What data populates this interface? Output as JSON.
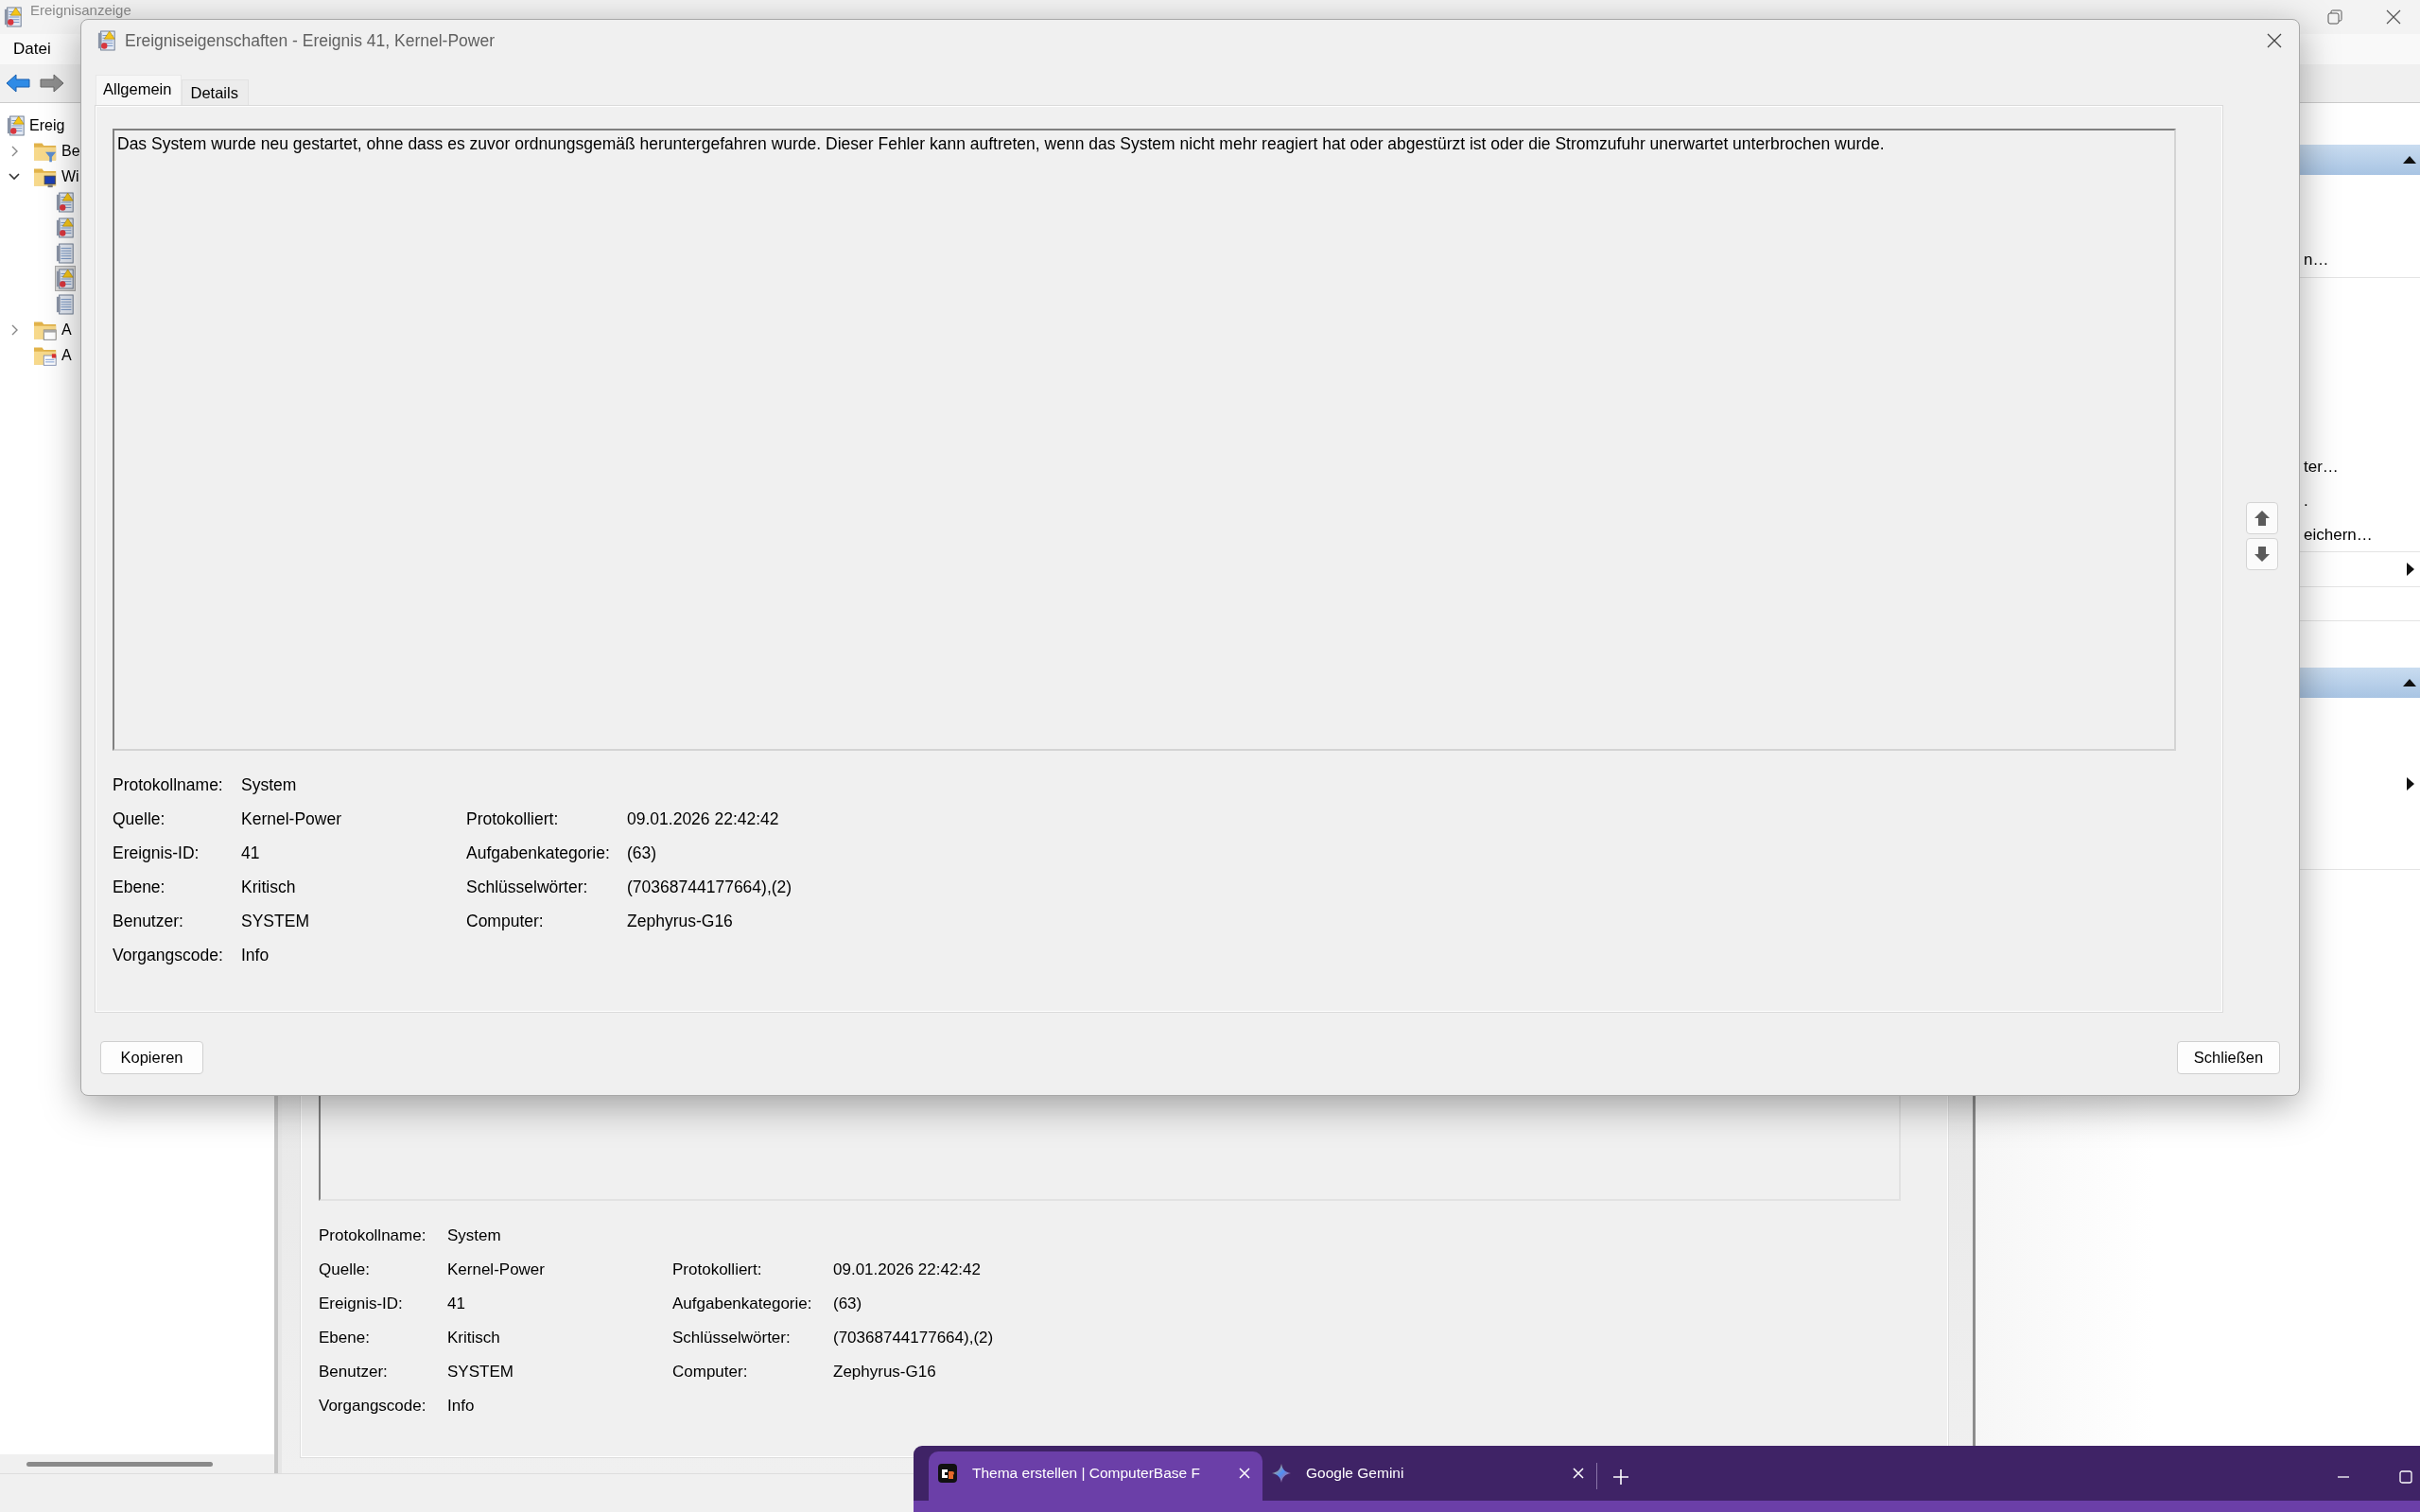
{
  "event_viewer": {
    "title": "Ereignisanzeige",
    "menu": [
      "Datei"
    ],
    "tree": [
      {
        "label": "Ereig",
        "kind": "viewer",
        "selected": false,
        "children": [
          {
            "label": "Be",
            "kind": "filter-folder",
            "selected": false,
            "expanded": false
          },
          {
            "label": "Wi",
            "kind": "computer-folder",
            "selected": false,
            "expanded": true,
            "children": [
              {
                "kind": "alert-log",
                "selected": false
              },
              {
                "kind": "alert-log",
                "selected": false
              },
              {
                "kind": "plain-log",
                "selected": false
              },
              {
                "kind": "alert-log",
                "selected": true
              },
              {
                "kind": "plain-log",
                "selected": false
              }
            ]
          },
          {
            "label": "A",
            "kind": "app-folder",
            "selected": false,
            "expanded": false
          },
          {
            "label": "A",
            "kind": "task-folder",
            "selected": false
          }
        ]
      }
    ],
    "actions": [
      {
        "items": [
          {
            "kind": "action",
            "label": "n…"
          },
          {
            "kind": "action",
            "label": "ter…"
          },
          {
            "kind": "action",
            "label": "."
          },
          {
            "kind": "action",
            "label": "eichern…"
          },
          {
            "kind": "submenu"
          }
        ]
      },
      {
        "items": [
          {
            "kind": "submenu"
          }
        ]
      }
    ],
    "details": {
      "fields_left": [
        {
          "label": "Protokollname:",
          "value": "System"
        },
        {
          "label": "Quelle:",
          "value": "Kernel-Power"
        },
        {
          "label": "Ereignis-ID:",
          "value": "41"
        },
        {
          "label": "Ebene:",
          "value": "Kritisch"
        },
        {
          "label": "Benutzer:",
          "value": "SYSTEM"
        },
        {
          "label": "Vorgangscode:",
          "value": "Info"
        }
      ],
      "fields_right": [
        {
          "label": "Protokolliert:",
          "value": "09.01.2026 22:42:42"
        },
        {
          "label": "Aufgabenkategorie:",
          "value": "(63)"
        },
        {
          "label": "Schlüsselwörter:",
          "value": "(70368744177664),(2)"
        },
        {
          "label": "Computer:",
          "value": "Zephyrus-G16"
        }
      ]
    }
  },
  "dialog": {
    "title": "Ereigniseigenschaften - Ereignis 41, Kernel-Power",
    "tabs": [
      {
        "label": "Allgemein",
        "selected": true
      },
      {
        "label": "Details",
        "selected": false
      }
    ],
    "message": "Das System wurde neu gestartet, ohne dass es zuvor ordnungsgemäß heruntergefahren wurde. Dieser Fehler kann auftreten, wenn das System nicht mehr reagiert hat oder abgestürzt ist oder die Stromzufuhr unerwartet unterbrochen wurde.",
    "fields_left": [
      {
        "label": "Protokollname:",
        "value": "System"
      },
      {
        "label": "Quelle:",
        "value": "Kernel-Power"
      },
      {
        "label": "Ereignis-ID:",
        "value": "41"
      },
      {
        "label": "Ebene:",
        "value": "Kritisch"
      },
      {
        "label": "Benutzer:",
        "value": "SYSTEM"
      },
      {
        "label": "Vorgangscode:",
        "value": "Info"
      }
    ],
    "fields_right": [
      {
        "label": "Protokolliert:",
        "value": "09.01.2026 22:42:42"
      },
      {
        "label": "Aufgabenkategorie:",
        "value": "(63)"
      },
      {
        "label": "Schlüsselwörter:",
        "value": "(70368744177664),(2)"
      },
      {
        "label": "Computer:",
        "value": "Zephyrus-G16"
      }
    ],
    "buttons": [
      {
        "label": "Kopieren",
        "kind": "left"
      },
      {
        "label": "Schließen",
        "kind": "right"
      }
    ]
  },
  "browser": {
    "tabs": [
      {
        "title": "Thema erstellen | ComputerBase F",
        "selected": true
      },
      {
        "title": "Google Gemini",
        "selected": false
      }
    ]
  }
}
